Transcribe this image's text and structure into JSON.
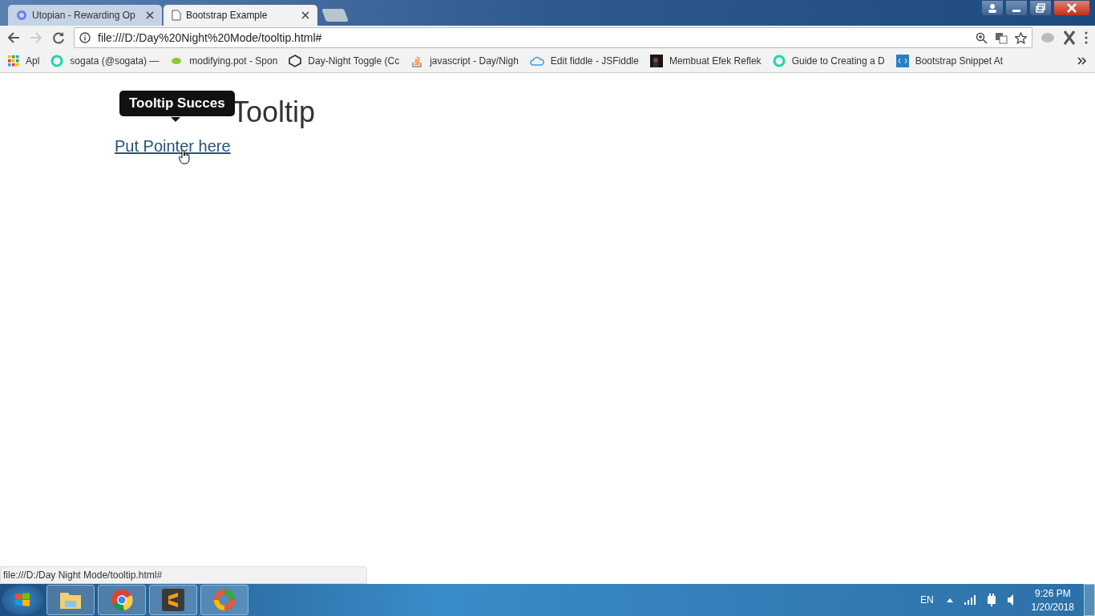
{
  "tabs": [
    {
      "title": "Utopian - Rewarding Op",
      "selected": false
    },
    {
      "title": "Bootstrap Example",
      "selected": true
    }
  ],
  "address_bar": {
    "url": "file:///D:/Day%20Night%20Mode/tooltip.html#"
  },
  "bookmarks": [
    {
      "title": "Apl"
    },
    {
      "title": "sogata (@sogata) — "
    },
    {
      "title": "modifying.pot - Spon"
    },
    {
      "title": "Day-Night Toggle (Cc"
    },
    {
      "title": "javascript - Day/Nigh"
    },
    {
      "title": "Edit fiddle - JSFiddle"
    },
    {
      "title": "Membuat Efek Reflek"
    },
    {
      "title": "Guide to Creating a D"
    },
    {
      "title": "Bootstrap Snippet At"
    }
  ],
  "page": {
    "heading": "Tooltip",
    "link": "Put Pointer here",
    "tooltip": "Tooltip Succes"
  },
  "status_url": "file:///D:/Day Night Mode/tooltip.html#",
  "taskbar": {
    "language": "EN",
    "time": "9:26 PM",
    "date": "1/20/2018"
  }
}
